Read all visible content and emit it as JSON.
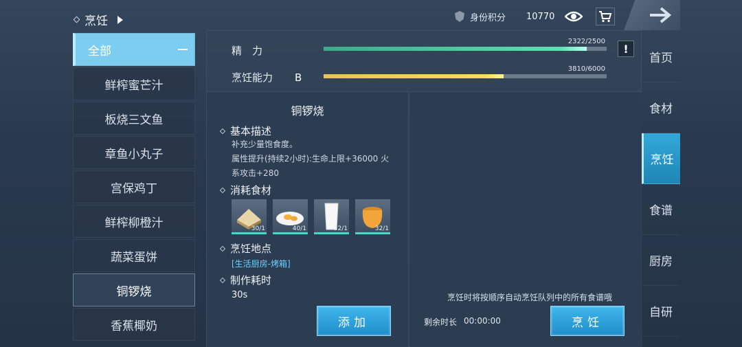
{
  "header": {
    "title": "烹饪",
    "rank_label": "身份积分",
    "rank_value": "10770"
  },
  "categories": [
    {
      "label": "全部"
    },
    {
      "label": "鲜榨蜜芒汁"
    },
    {
      "label": "板烧三文鱼"
    },
    {
      "label": "章鱼小丸子"
    },
    {
      "label": "宫保鸡丁"
    },
    {
      "label": "鲜榨柳橙汁"
    },
    {
      "label": "蔬菜蛋饼"
    },
    {
      "label": "铜锣烧"
    },
    {
      "label": "香蕉椰奶"
    }
  ],
  "nav": [
    {
      "label": "首页"
    },
    {
      "label": "食材"
    },
    {
      "label": "烹饪"
    },
    {
      "label": "食谱"
    },
    {
      "label": "厨房"
    },
    {
      "label": "自研"
    }
  ],
  "stats": {
    "energy_label": "精　力",
    "energy_value": "2322/2500",
    "energy_fraction": 0.929,
    "skill_label": "烹饪能力",
    "skill_grade": "B",
    "skill_value": "3810/6000",
    "skill_fraction": 0.635,
    "alert_glyph": "!"
  },
  "detail": {
    "dish_name": "铜锣烧",
    "basic_title": "基本描述",
    "desc_line1": "补充少量饱食度。",
    "desc_line2": "属性提升(持续2小时):生命上限+36000 火",
    "desc_line3": "系攻击+280",
    "ingr_title": "消耗食材",
    "ingredients": [
      {
        "icon": "flour-icon",
        "qty": "30/1"
      },
      {
        "icon": "fried-egg-icon",
        "qty": "40/1"
      },
      {
        "icon": "milk-glass-icon",
        "qty": "32/1"
      },
      {
        "icon": "honey-jar-icon",
        "qty": "32/1"
      }
    ],
    "location_title": "烹饪地点",
    "location_value": "[生活厨房-烤箱]",
    "time_title": "制作耗时",
    "time_value": "30s",
    "add_label": "添加"
  },
  "queue": {
    "hint": "烹饪时将按顺序自动烹饪队列中的所有食谱哦",
    "remain_label": "剩余时长",
    "remain_value": "00:00:00",
    "cook_label": "烹饪"
  },
  "colors": {
    "accent": "#2fa3d6",
    "energy_bar": "#5ee0b0",
    "skill_bar": "#f6db62",
    "location_text": "#6ccfff"
  }
}
